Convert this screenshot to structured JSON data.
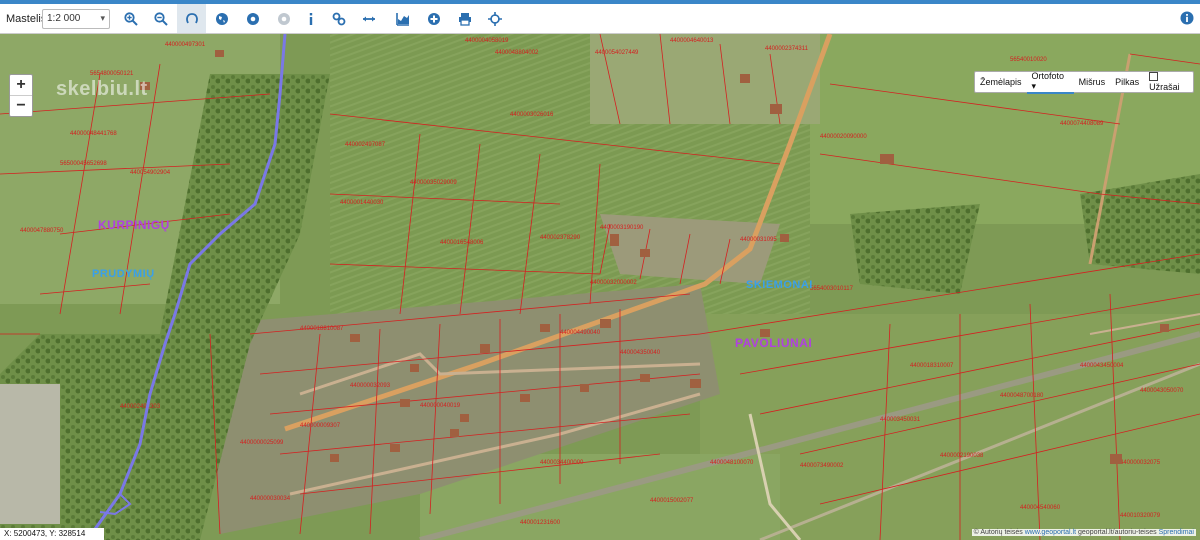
{
  "toolbar": {
    "scale_label": "Mastelis",
    "scale_value": "1:2 000",
    "tools": [
      "zoom-in-icon",
      "zoom-out-icon",
      "lasso-icon",
      "globe-icon",
      "back-icon",
      "forward-icon",
      "info-icon",
      "link-icon",
      "measure-icon",
      "profile-chart-icon",
      "add-circle-icon",
      "print-icon",
      "crosshair-icon"
    ],
    "info_icon": "info-circle-icon"
  },
  "map": {
    "watermark": "skelbiu.lt",
    "zoom_in": "+",
    "zoom_out": "−",
    "layers": {
      "zemelapis": "Žemėlapis",
      "ortofoto": "Ortofoto",
      "ortofoto_caret": "▾",
      "misrus": "Mišrus",
      "pilkas": "Pilkas",
      "uzrasai": "Užrašai"
    },
    "coords": "X: 5200473, Y: 328514",
    "credits": {
      "prefix": "© Autorių teisės",
      "link1": "www.geoportal.lt",
      "sep": "geoportal.lt/autoriu-teises",
      "link2": "Sprendimai"
    },
    "colors": {
      "accent": "#3a86c8",
      "parcel_lines": "#d42020",
      "river_line": "#7070e0",
      "place_purple": "#b040e0",
      "place_blue": "#3aa0e8"
    }
  },
  "places": [
    {
      "label": "KURPINIGŲ"
    },
    {
      "label": "PRUDYMIŲ"
    },
    {
      "label": "SKIEMONAI"
    },
    {
      "label": "PAVOLIUNAI"
    }
  ]
}
